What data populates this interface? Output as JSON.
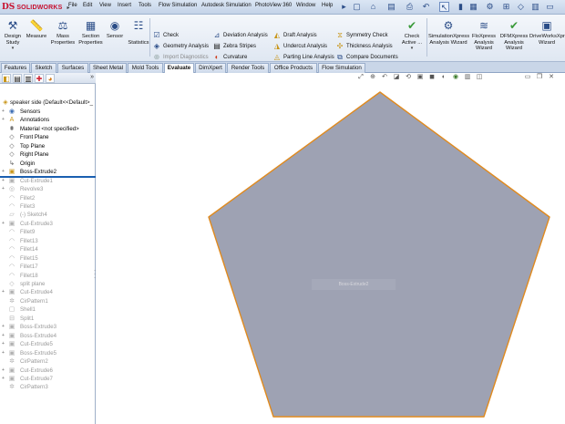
{
  "app": {
    "logo_ds": "DS",
    "logo_name": "SOLIDWORKS",
    "menu": [
      "File",
      "Edit",
      "View",
      "Insert",
      "Tools",
      "Flow Simulation",
      "Autodesk Simulation",
      "PhotoView 360",
      "Window",
      "Help"
    ]
  },
  "command_manager": {
    "design_study": "Design Study",
    "measure": "Measure",
    "mass_properties": "Mass Properties",
    "section_properties": "Section Properties",
    "sensor": "Sensor",
    "statistics": "Statistics",
    "check": "Check",
    "geometry_analysis": "Geometry Analysis",
    "import_diagnostics": "Import Diagnostics",
    "deviation_analysis": "Deviation Analysis",
    "zebra_stripes": "Zebra Stripes",
    "curvature": "Curvature",
    "draft_analysis": "Draft Analysis",
    "undercut_analysis": "Undercut Analysis",
    "parting_line_analysis": "Parting Line Analysis",
    "symmetry_check": "Symmetry Check",
    "thickness_analysis": "Thickness Analysis",
    "compare_documents": "Compare Documents",
    "check_active": "Check Active ...",
    "simulationxpress": "SimulationXpress Analysis Wizard",
    "floxpress": "FloXpress Analysis Wizard",
    "dfmxpress": "DFMXpress Analysis Wizard",
    "driveworksxpress": "DriveWorksXpress Wizard"
  },
  "tabs": [
    "Features",
    "Sketch",
    "Surfaces",
    "Sheet Metal",
    "Mold Tools",
    "Evaluate",
    "DimXpert",
    "Render Tools",
    "Office Products",
    "Flow Simulation"
  ],
  "active_tab": "Evaluate",
  "tree": {
    "root": "speaker side  (Default<<Default>_",
    "items": [
      {
        "label": "Sensors",
        "state": "active",
        "icon": "sensor-icon",
        "glyph": "◉",
        "expand": "+"
      },
      {
        "label": "Annotations",
        "state": "active",
        "icon": "annotations-icon",
        "glyph": "A",
        "expand": "+"
      },
      {
        "label": "Material <not specified>",
        "state": "active",
        "icon": "material-icon",
        "glyph": "⩩",
        "expand": ""
      },
      {
        "label": "Front Plane",
        "state": "active",
        "icon": "plane-icon",
        "glyph": "◇",
        "expand": ""
      },
      {
        "label": "Top Plane",
        "state": "active",
        "icon": "plane-icon",
        "glyph": "◇",
        "expand": ""
      },
      {
        "label": "Right Plane",
        "state": "active",
        "icon": "plane-icon",
        "glyph": "◇",
        "expand": ""
      },
      {
        "label": "Origin",
        "state": "active",
        "icon": "origin-icon",
        "glyph": "↳",
        "expand": ""
      },
      {
        "label": "Boss-Extrude2",
        "state": "rollback",
        "icon": "boss-extrude-icon",
        "glyph": "▣",
        "expand": "+"
      },
      {
        "label": "Cut-Extrude1",
        "state": "suppressed",
        "icon": "cut-extrude-icon",
        "glyph": "▣",
        "expand": "+"
      },
      {
        "label": "Revolve3",
        "state": "suppressed",
        "icon": "revolve-icon",
        "glyph": "◎",
        "expand": "+"
      },
      {
        "label": "Fillet2",
        "state": "suppressed",
        "icon": "fillet-icon",
        "glyph": "◠",
        "expand": ""
      },
      {
        "label": "Fillet3",
        "state": "suppressed",
        "icon": "fillet-icon",
        "glyph": "◠",
        "expand": ""
      },
      {
        "label": "(-) Sketch4",
        "state": "suppressed",
        "icon": "sketch-icon",
        "glyph": "▱",
        "expand": ""
      },
      {
        "label": "Cut-Extrude3",
        "state": "suppressed",
        "icon": "cut-extrude-icon",
        "glyph": "▣",
        "expand": "+"
      },
      {
        "label": "Fillet9",
        "state": "suppressed",
        "icon": "fillet-icon",
        "glyph": "◠",
        "expand": ""
      },
      {
        "label": "Fillet13",
        "state": "suppressed",
        "icon": "fillet-icon",
        "glyph": "◠",
        "expand": ""
      },
      {
        "label": "Fillet14",
        "state": "suppressed",
        "icon": "fillet-icon",
        "glyph": "◠",
        "expand": ""
      },
      {
        "label": "Fillet15",
        "state": "suppressed",
        "icon": "fillet-icon",
        "glyph": "◠",
        "expand": ""
      },
      {
        "label": "Fillet17",
        "state": "suppressed",
        "icon": "fillet-icon",
        "glyph": "◠",
        "expand": ""
      },
      {
        "label": "Fillet18",
        "state": "suppressed",
        "icon": "fillet-icon",
        "glyph": "◠",
        "expand": ""
      },
      {
        "label": "split plane",
        "state": "suppressed",
        "icon": "plane-icon",
        "glyph": "◇",
        "expand": ""
      },
      {
        "label": "Cut-Extrude4",
        "state": "suppressed",
        "icon": "cut-extrude-icon",
        "glyph": "▣",
        "expand": "+"
      },
      {
        "label": "CirPattern1",
        "state": "suppressed",
        "icon": "circular-pattern-icon",
        "glyph": "✲",
        "expand": ""
      },
      {
        "label": "Shell1",
        "state": "suppressed",
        "icon": "shell-icon",
        "glyph": "▢",
        "expand": ""
      },
      {
        "label": "Split1",
        "state": "suppressed",
        "icon": "split-icon",
        "glyph": "⊟",
        "expand": ""
      },
      {
        "label": "Boss-Extrude3",
        "state": "suppressed",
        "icon": "boss-extrude-icon",
        "glyph": "▣",
        "expand": "+"
      },
      {
        "label": "Boss-Extrude4",
        "state": "suppressed",
        "icon": "boss-extrude-icon",
        "glyph": "▣",
        "expand": "+"
      },
      {
        "label": "Cut-Extrude5",
        "state": "suppressed",
        "icon": "cut-extrude-icon",
        "glyph": "▣",
        "expand": "+"
      },
      {
        "label": "Boss-Extrude5",
        "state": "suppressed",
        "icon": "boss-extrude-icon",
        "glyph": "▣",
        "expand": "+"
      },
      {
        "label": "CirPattern2",
        "state": "suppressed",
        "icon": "circular-pattern-icon",
        "glyph": "✲",
        "expand": ""
      },
      {
        "label": "Cut-Extrude6",
        "state": "suppressed",
        "icon": "cut-extrude-icon",
        "glyph": "▣",
        "expand": "+"
      },
      {
        "label": "Cut-Extrude7",
        "state": "suppressed",
        "icon": "cut-extrude-icon",
        "glyph": "▣",
        "expand": "+"
      },
      {
        "label": "CirPattern3",
        "state": "suppressed",
        "icon": "circular-pattern-icon",
        "glyph": "✲",
        "expand": ""
      }
    ]
  },
  "viewport": {
    "face_label": "Boss-Extrude2",
    "part_fill": "#9ea2b3",
    "part_edge": "#e08a1e"
  },
  "colors": {
    "rollback_bar": "#1b5fb0",
    "brand_red": "#c8102e"
  }
}
